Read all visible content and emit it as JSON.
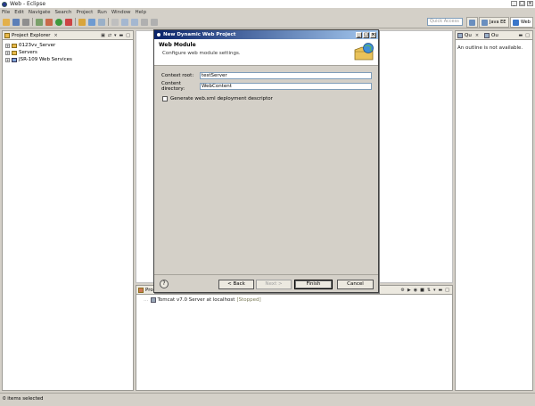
{
  "window": {
    "title": "Web - Eclipse"
  },
  "menu": [
    "File",
    "Edit",
    "Navigate",
    "Search",
    "Project",
    "Run",
    "Window",
    "Help"
  ],
  "toolbar": {
    "quick_access_placeholder": "Quick Access"
  },
  "perspectives": [
    {
      "label": "Java EE"
    },
    {
      "label": "Web"
    }
  ],
  "project_explorer": {
    "title": "Project Explorer",
    "items": [
      {
        "label": "0123vv_Server",
        "expander": "+"
      },
      {
        "label": "Servers",
        "expander": "+"
      },
      {
        "label": "JSR-109 Web Services",
        "expander": "+"
      }
    ]
  },
  "outline": {
    "tab1": "Qu",
    "tab2": "Ou",
    "message": "An outline is not available."
  },
  "servers": {
    "tab_label": "Probl",
    "row_label": "Tomcat v7.0 Server at localhost",
    "row_state": "[Stopped]"
  },
  "dialog": {
    "title": "New Dynamic Web Project",
    "header_title": "Web Module",
    "header_subtitle": "Configure web module settings.",
    "context_root_label": "Context root:",
    "context_root_value": "testServer",
    "content_dir_label": "Content directory:",
    "content_dir_value": "WebContent",
    "generate_label": "Generate web.xml deployment descriptor",
    "help": "?",
    "back": "< Back",
    "next": "Next >",
    "finish": "Finish",
    "cancel": "Cancel"
  },
  "statusbar": {
    "text": "0 items selected"
  },
  "colors": {
    "dialog_title_start": "#0a246a",
    "dialog_title_end": "#a6caf0",
    "panel_bg": "#ffffff",
    "chrome_bg": "#d4d0c8"
  }
}
